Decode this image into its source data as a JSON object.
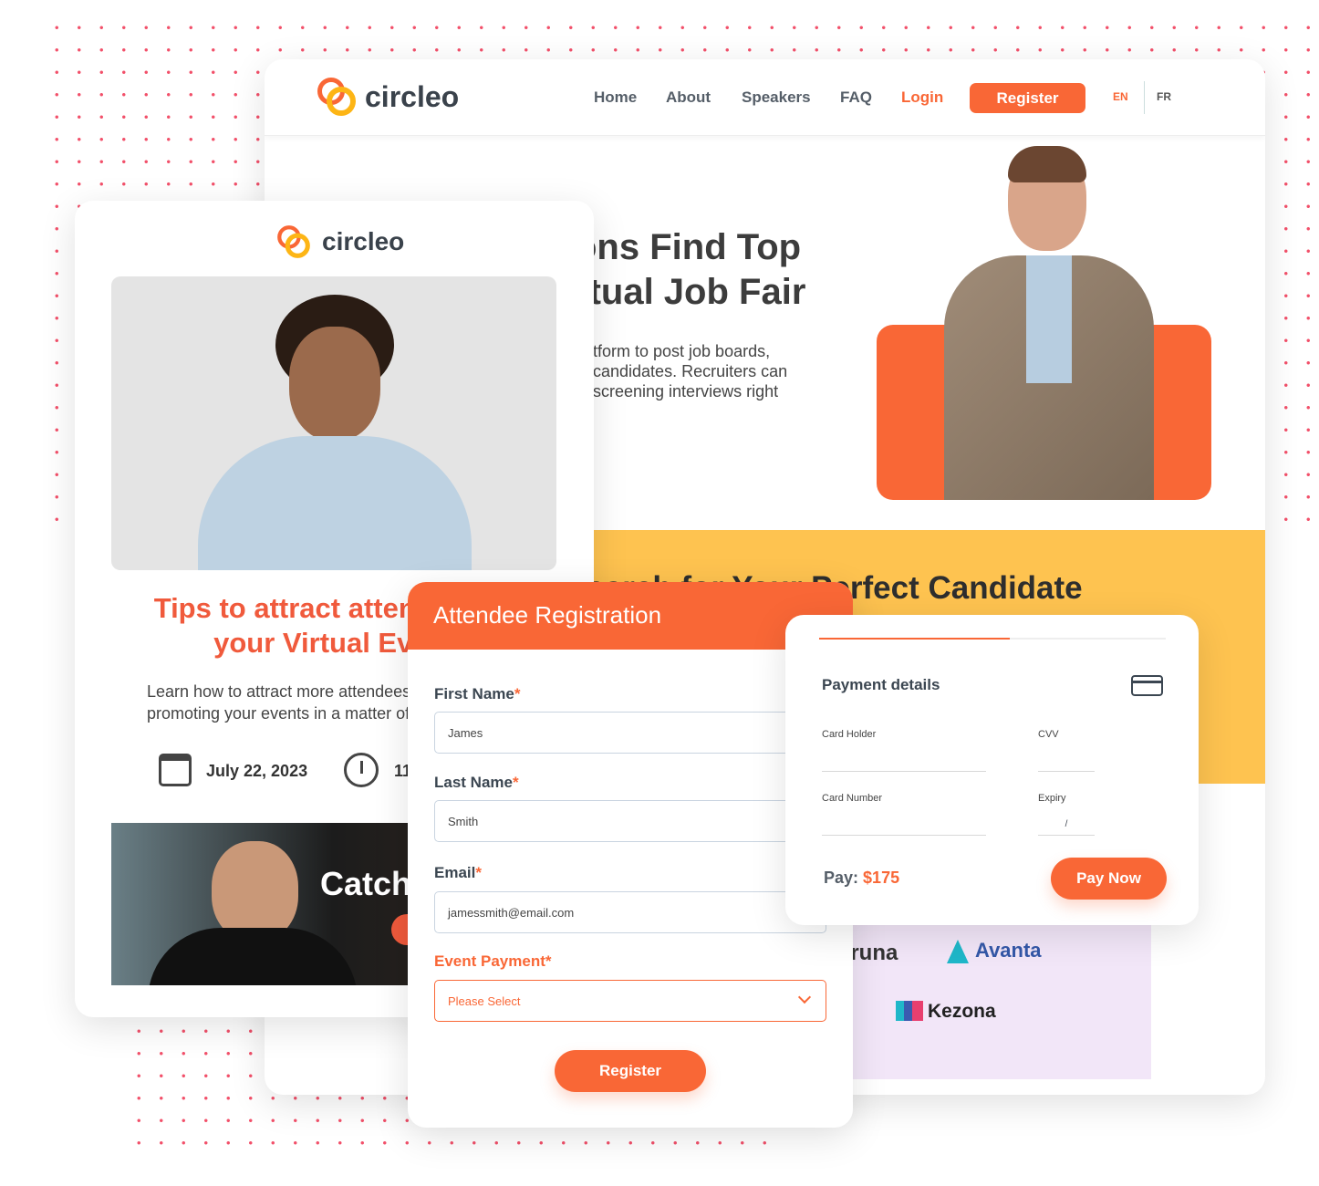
{
  "brand": {
    "name": "circleo",
    "accent": "#F96736",
    "yellow": "#FEC350",
    "title_red": "#F05A3C"
  },
  "nav": {
    "items": [
      "Home",
      "About",
      "Speakers",
      "FAQ"
    ],
    "login": "Login",
    "register": "Register",
    "lang": [
      "EN",
      "FR"
    ]
  },
  "hero": {
    "title_lines": [
      "ons Find Top",
      "rtual Job Fair"
    ],
    "text_lines": [
      "tform to post job boards,",
      "candidates. Recruiters can",
      "screening interviews right"
    ]
  },
  "band": {
    "title": "Search for Your Perfect Candidate"
  },
  "logos": [
    "Aruna",
    "Avanta",
    "Kezona"
  ],
  "article": {
    "title_lines": [
      "Tips to attract attendees to",
      "your Virtual Event"
    ],
    "desc_lines": [
      "Learn how to attract more attendees by",
      "promoting your events in a matter of"
    ],
    "date": "July 22, 2023",
    "time": "11",
    "banner": "Catch"
  },
  "form": {
    "title": "Attendee Registration",
    "fields": [
      {
        "label": "First Name",
        "value": "James"
      },
      {
        "label": "Last Name",
        "value": "Smith"
      },
      {
        "label": "Email",
        "value": "jamessmith@email.com"
      }
    ],
    "payment_label": "Event Payment",
    "payment_placeholder": "Please Select",
    "required": "*",
    "submit": "Register"
  },
  "payment": {
    "title": "Payment details",
    "card_holder": "Card Holder",
    "cvv": "CVV",
    "card_number": "Card Number",
    "expiry": "Expiry",
    "expiry_sep": "/",
    "pay_label": "Pay:",
    "amount": "$175",
    "button": "Pay Now",
    "progress": 0.55
  }
}
